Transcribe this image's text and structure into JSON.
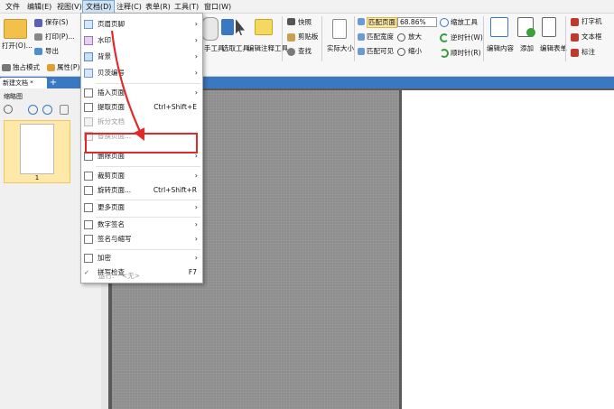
{
  "menubar": {
    "items": [
      "文件",
      "编辑(E)",
      "视图(V)",
      "文档(D)",
      "注释(C)",
      "表单(R)",
      "工具(T)",
      "窗口(W)"
    ]
  },
  "ribbon": {
    "open": "打开(O)...",
    "save": "保存(S)",
    "print": "打印(P)...",
    "export": "导出",
    "solo": "独占模式",
    "props": "属性(P)...",
    "snapshot": "快照",
    "clipboard": "剪贴板",
    "find": "查找",
    "actual": "实际大小",
    "fit_page": "匹配页面",
    "fit_width": "匹配宽度",
    "fit_visible": "匹配可见",
    "zoom_val": "68.86%",
    "zoom_tool": "缩放工具",
    "zoom_in": "放大",
    "zoom_out": "缩小",
    "rot_ccw": "逆时针(W)",
    "rot_cw": "顺时针(R)",
    "edit_content": "编辑内容",
    "add": "添加",
    "edit_form": "编辑表单",
    "typewriter": "打字机",
    "textbox": "文本框",
    "annot": "标注",
    "hand_tool": "手工具",
    "select_tool": "选取工具",
    "edit_annot": "编辑注释工具"
  },
  "tab": {
    "name": "新建文档 *",
    "plus": "+"
  },
  "leftpanel": {
    "title": "缩略图",
    "thumb_num": "1"
  },
  "dropdown": {
    "i0": "页眉页脚",
    "i1": "水印",
    "i2": "背景",
    "i3": "贝茨编号",
    "i4": "插入页面",
    "i5": "提取页面",
    "i5sc": "Ctrl+Shift+E",
    "i6": "拆分文档",
    "i7": "替换页面...",
    "i8": "删除页面",
    "i9": "裁剪页面",
    "i10": "旋转页面...",
    "i10sc": "Ctrl+Shift+R",
    "i11": "更多页面",
    "i12": "数字签名",
    "i13": "签名与缩写",
    "i14": "加密",
    "i15": "拼写检查",
    "i15sc": "F7",
    "i16": "运行:",
    "i16v": "<无>",
    "arrow": "›"
  },
  "watermark": {
    "logo": "Bai 经验",
    "url": "jingyan.baidu.com"
  },
  "colors": {
    "accent": "#3b78c2",
    "highlight": "#e02a2a",
    "thumb": "#ffe9a8"
  }
}
